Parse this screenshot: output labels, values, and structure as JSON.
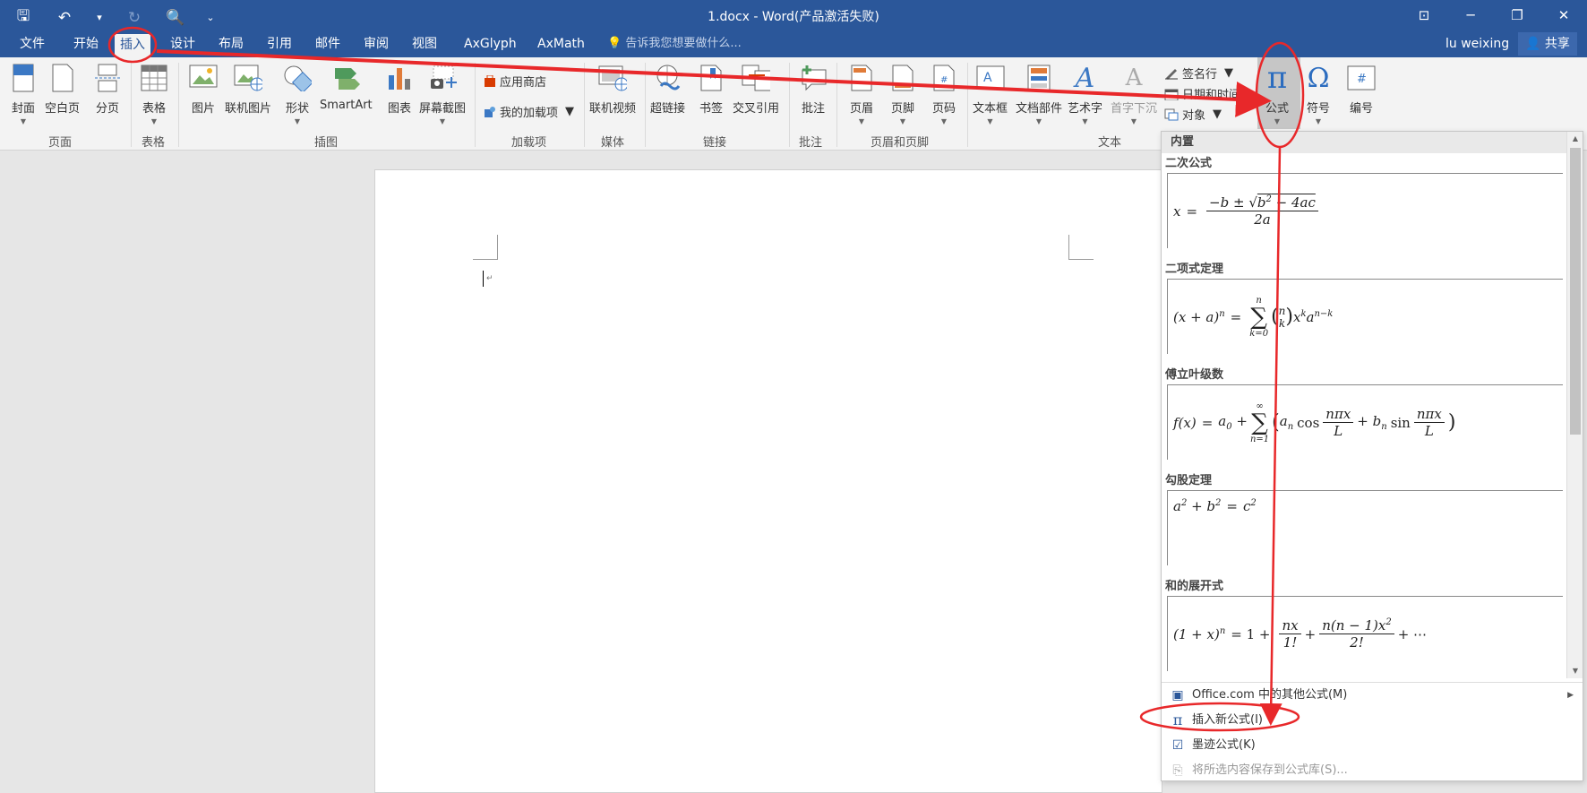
{
  "titlebar": {
    "title": "1.docx - Word(产品激活失败)",
    "qat": {
      "save": "🖫",
      "undo": "↶",
      "undo_dd": "▾",
      "redo": "↻",
      "preview": "🔍",
      "customize": "⌄"
    },
    "window": {
      "ribbon_display": "⊡",
      "minimize": "─",
      "restore": "❐",
      "close": "✕"
    }
  },
  "tabs": {
    "items": [
      "文件",
      "开始",
      "插入",
      "设计",
      "布局",
      "引用",
      "邮件",
      "审阅",
      "视图",
      "AxGlyph",
      "AxMath"
    ],
    "active": "插入",
    "tellme": "💡 告诉我您想要做什么...",
    "user": "lu weixing",
    "share": "👤 共享"
  },
  "ribbon": {
    "buttons": {
      "cover": "封面",
      "blank_page": "空白页",
      "page_break": "分页",
      "table": "表格",
      "picture": "图片",
      "online_picture": "联机图片",
      "shapes": "形状",
      "smartart": "SmartArt",
      "chart": "图表",
      "screenshot": "屏幕截图",
      "store": "应用商店",
      "my_addins": "我的加载项",
      "online_video": "联机视频",
      "hyperlink": "超链接",
      "bookmark": "书签",
      "cross_ref": "交叉引用",
      "comment": "批注",
      "header": "页眉",
      "footer": "页脚",
      "page_number": "页码",
      "textbox": "文本框",
      "quick_parts": "文档部件",
      "wordart": "艺术字",
      "dropcap": "首字下沉",
      "signature": "签名行",
      "datetime": "日期和时间",
      "object": "对象",
      "equation": "公式",
      "symbol": "符号",
      "number": "编号"
    },
    "groups": {
      "pages": "页面",
      "tables": "表格",
      "illustrations": "插图",
      "addins": "加载项",
      "media": "媒体",
      "links": "链接",
      "comments": "批注",
      "header_footer": "页眉和页脚",
      "text": "文本"
    },
    "icons": {
      "equation": "π",
      "symbol": "Ω",
      "number": "#",
      "wordart": "A",
      "dropcap": "A"
    }
  },
  "gallery": {
    "header": "内置",
    "equations": [
      {
        "name": "二次公式"
      },
      {
        "name": "二项式定理"
      },
      {
        "name": "傅立叶级数"
      },
      {
        "name": "勾股定理"
      },
      {
        "name": "和的展开式"
      }
    ],
    "footer": {
      "more": "Office.com 中的其他公式(M)",
      "insert_new": "插入新公式(I)",
      "ink": "墨迹公式(K)",
      "save_selection": "将所选内容保存到公式库(S)..."
    }
  },
  "annotation_color": "#e8282a",
  "accent_color": "#2b579a"
}
